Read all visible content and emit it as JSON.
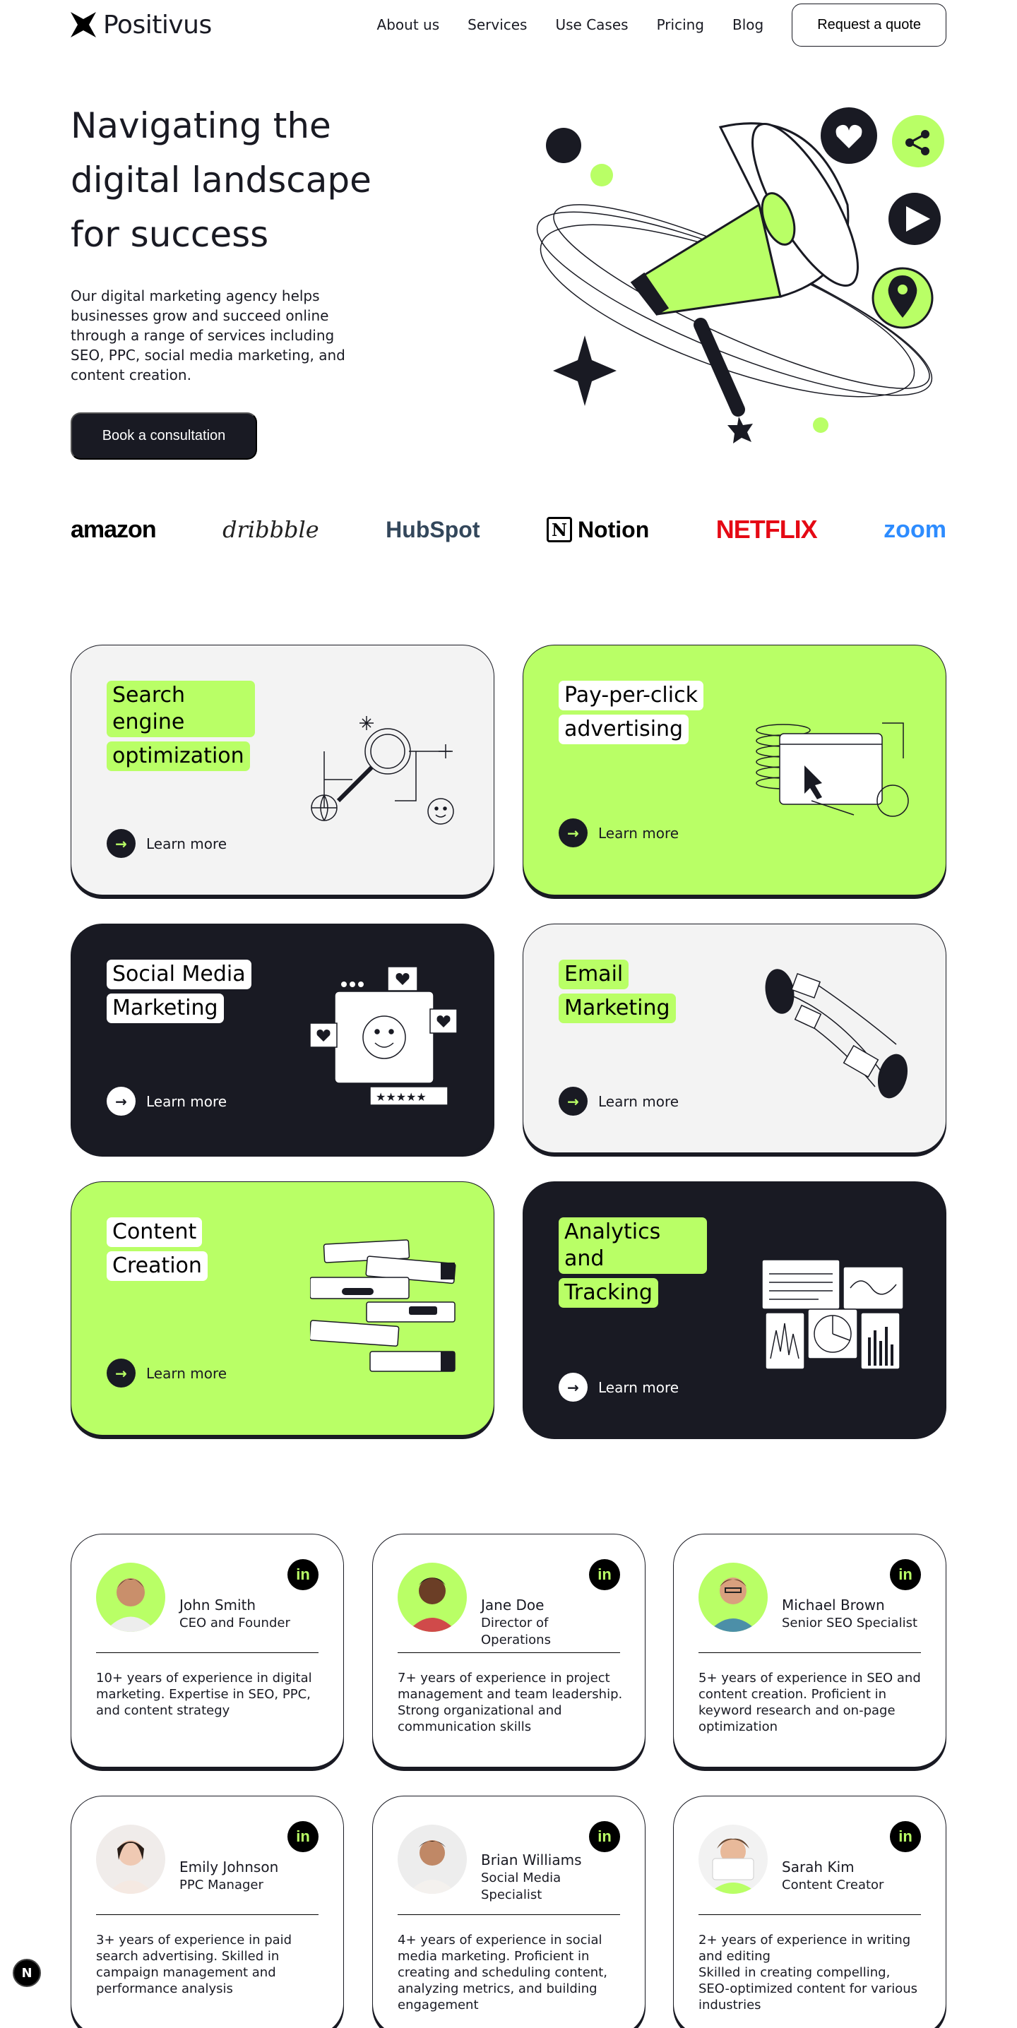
{
  "nav": {
    "logo": "Positivus",
    "links": [
      "About us",
      "Services",
      "Use Cases",
      "Pricing",
      "Blog"
    ],
    "cta": "Request a quote"
  },
  "hero": {
    "title": "Navigating the digital landscape for success",
    "description": "Our digital marketing agency helps businesses grow and succeed online through a range of services including SEO, PPC, social media marketing, and content creation.",
    "cta": "Book a consultation"
  },
  "brands": [
    "amazon",
    "dribbble",
    "HubSpot",
    "Notion",
    "NETFLIX",
    "zoom"
  ],
  "services": [
    {
      "lines": [
        "Search engine",
        "optimization"
      ],
      "theme": "grey",
      "learn": "Learn more"
    },
    {
      "lines": [
        "Pay-per-click",
        "advertising"
      ],
      "theme": "green",
      "learn": "Learn more"
    },
    {
      "lines": [
        "Social Media",
        "Marketing"
      ],
      "theme": "dark",
      "learn": "Learn more"
    },
    {
      "lines": [
        "Email",
        "Marketing"
      ],
      "theme": "grey",
      "learn": "Learn more"
    },
    {
      "lines": [
        "Content",
        "Creation"
      ],
      "theme": "green",
      "learn": "Learn more"
    },
    {
      "lines": [
        "Analytics and",
        "Tracking"
      ],
      "theme": "dark",
      "learn": "Learn more"
    }
  ],
  "team": [
    {
      "name": "John Smith",
      "role": "CEO and Founder",
      "bio": "10+ years of experience in digital marketing. Expertise in SEO, PPC, and content strategy",
      "social": "in"
    },
    {
      "name": "Jane Doe",
      "role": "Director of Operations",
      "bio": "7+ years of experience in project management and team leadership. Strong organizational and communication skills",
      "social": "in"
    },
    {
      "name": "Michael Brown",
      "role": "Senior SEO Specialist",
      "bio": "5+ years of experience in SEO and content creation. Proficient in keyword research and on-page optimization",
      "social": "in"
    },
    {
      "name": "Emily Johnson",
      "role": "PPC Manager",
      "bio": "3+ years of experience in paid search advertising. Skilled in campaign management and performance analysis",
      "social": "in"
    },
    {
      "name": "Brian Williams",
      "role": "Social Media Specialist",
      "bio": "4+ years of experience in social media marketing. Proficient in creating and scheduling content, analyzing metrics, and building engagement",
      "social": "in"
    },
    {
      "name": "Sarah Kim",
      "role": "Content Creator",
      "bio": "2+ years of experience in writing and editing\nSkilled in creating compelling, SEO-optimized content for various industries",
      "social": "in"
    }
  ],
  "badge": "N",
  "colors": {
    "accent": "#B9FF66",
    "dark": "#191A23",
    "grey": "#F3F3F3"
  }
}
